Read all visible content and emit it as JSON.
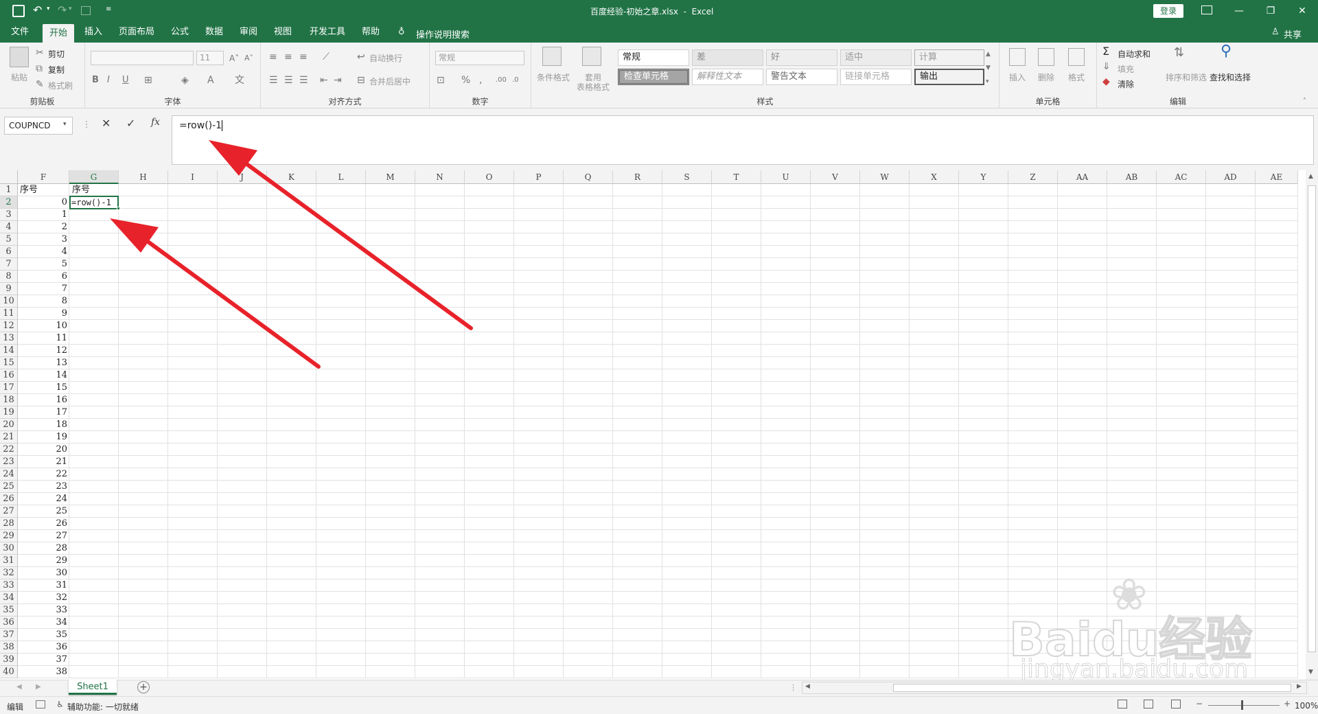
{
  "title": {
    "doc": "百度经验-初始之章.xlsx",
    "sep": "-",
    "app": "Excel",
    "login": "登录"
  },
  "tabs": [
    "文件",
    "开始",
    "插入",
    "页面布局",
    "公式",
    "数据",
    "审阅",
    "视图",
    "开发工具",
    "帮助"
  ],
  "tell_me": "操作说明搜索",
  "share": "共享",
  "ribbon": {
    "clipboard": {
      "paste": "粘贴",
      "cut": "剪切",
      "copy": "复制",
      "format_painter": "格式刷",
      "label": "剪贴板"
    },
    "font": {
      "size": "11",
      "label": "字体",
      "bold": "B",
      "italic": "I",
      "underline": "U"
    },
    "align": {
      "wrap": "自动换行",
      "merge": "合并后居中",
      "label": "对齐方式"
    },
    "number": {
      "format": "常规",
      "percent": "%",
      "label": "数字"
    },
    "styles": {
      "cond_fmt": "条件格式",
      "table_fmt_1": "套用",
      "table_fmt_2": "表格格式",
      "cells": [
        "常规",
        "差",
        "好",
        "适中",
        "计算",
        "检查单元格",
        "解释性文本",
        "警告文本",
        "链接单元格",
        "输出"
      ],
      "label": "样式"
    },
    "cells": {
      "insert": "插入",
      "delete": "删除",
      "format": "格式",
      "label": "单元格"
    },
    "editing": {
      "autosum": "自动求和",
      "fill": "填充",
      "clear": "清除",
      "sort": "排序和筛选",
      "find": "查找和选择",
      "label": "编辑"
    }
  },
  "namebox": "COUPNCD",
  "formula": "=row()-1",
  "columns": [
    "F",
    "G",
    "H",
    "I",
    "J",
    "K",
    "L",
    "M",
    "N",
    "O",
    "P",
    "Q",
    "R",
    "S",
    "T",
    "U",
    "V",
    "W",
    "X",
    "Y",
    "Z",
    "AA",
    "AB",
    "AC",
    "AD",
    "AE"
  ],
  "rows": [
    "1",
    "2",
    "3",
    "4",
    "5",
    "6",
    "7",
    "8",
    "9",
    "10",
    "11",
    "12",
    "13",
    "14",
    "15",
    "16",
    "17",
    "18",
    "19",
    "20",
    "21",
    "22",
    "23",
    "24",
    "25",
    "26",
    "27",
    "28",
    "29",
    "30",
    "31",
    "32",
    "33",
    "34",
    "35",
    "36",
    "37",
    "38",
    "39",
    "40"
  ],
  "f_header": "序号",
  "g_header": "序号",
  "f_values": [
    "0",
    "1",
    "2",
    "3",
    "4",
    "5",
    "6",
    "7",
    "8",
    "9",
    "10",
    "11",
    "12",
    "13",
    "14",
    "15",
    "16",
    "17",
    "18",
    "19",
    "20",
    "21",
    "22",
    "23",
    "24",
    "25",
    "26",
    "27",
    "28",
    "29",
    "30",
    "31",
    "32",
    "33",
    "34",
    "35",
    "36",
    "37",
    "38"
  ],
  "g_editing": "=row()-1",
  "sheet": "Sheet1",
  "status": {
    "mode": "编辑",
    "accessibility": "辅助功能: 一切就绪",
    "zoom": "100%"
  },
  "watermark": {
    "brand": "Baidu经验",
    "url": "jingyan.baidu.com"
  },
  "colors": {
    "excel_green": "#217346",
    "arrow_red": "#e8222a"
  }
}
